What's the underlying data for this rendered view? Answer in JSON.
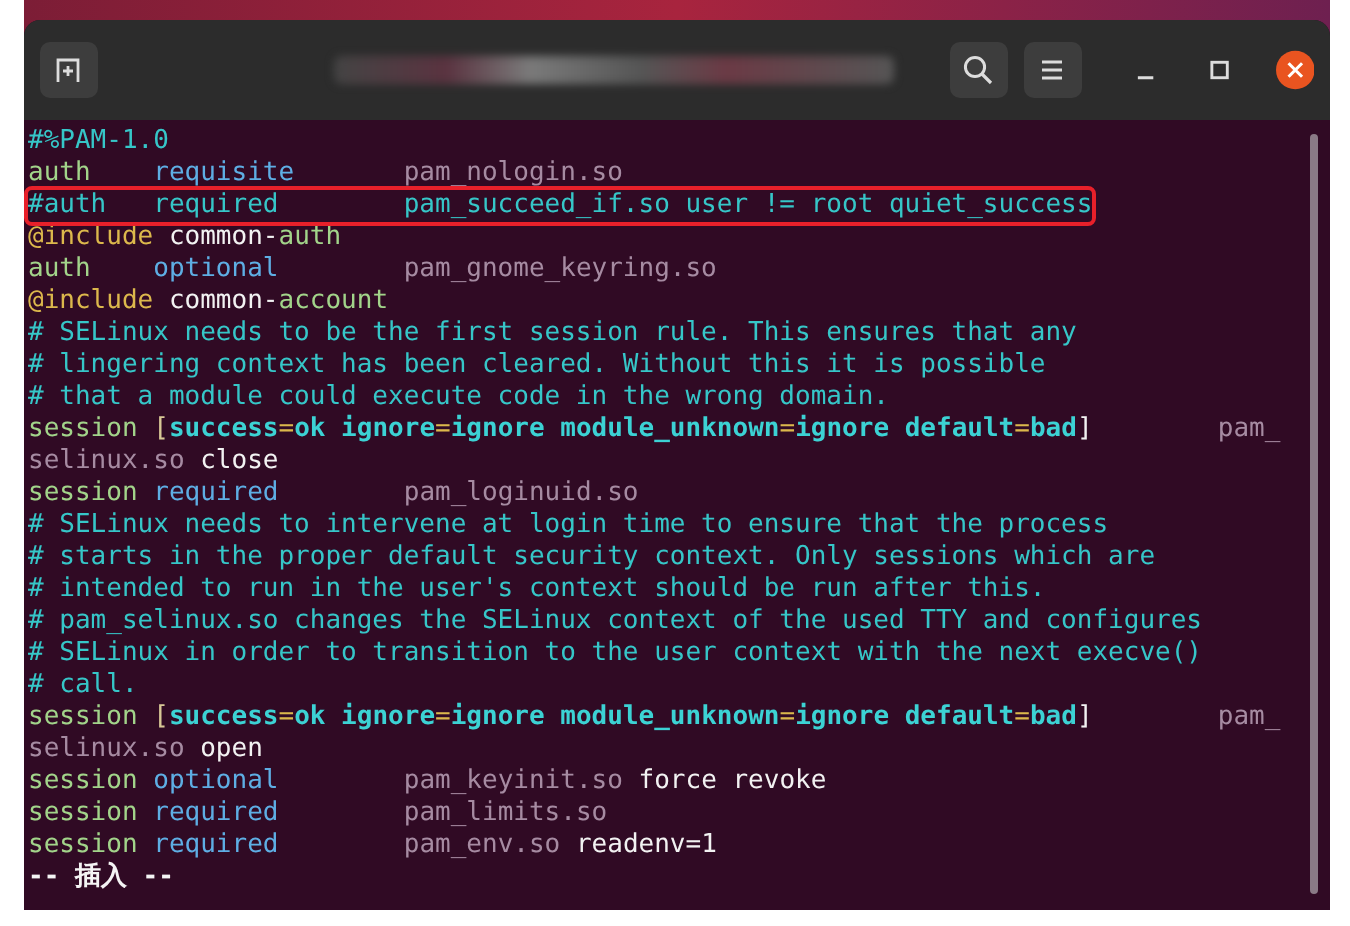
{
  "lines": [
    {
      "highlighted": false,
      "segments": [
        {
          "kind": "comment",
          "text": "#%PAM-1.0"
        }
      ]
    },
    {
      "highlighted": false,
      "segments": [
        {
          "kind": "facility",
          "text": "auth"
        },
        {
          "kind": "control",
          "text": "    requisite"
        },
        {
          "kind": "module",
          "text": "       pam_nologin.so"
        }
      ]
    },
    {
      "highlighted": true,
      "segments": [
        {
          "kind": "comment",
          "text": "#auth   required        pam_succeed_if.so user != root quiet_success"
        }
      ]
    },
    {
      "highlighted": false,
      "segments": [
        {
          "kind": "include",
          "text": "@include"
        },
        {
          "kind": "plain",
          "text": " common-"
        },
        {
          "kind": "facility",
          "text": "auth"
        }
      ]
    },
    {
      "highlighted": false,
      "segments": [
        {
          "kind": "facility",
          "text": "auth"
        },
        {
          "kind": "control",
          "text": "    optional"
        },
        {
          "kind": "module",
          "text": "        pam_gnome_keyring.so"
        }
      ]
    },
    {
      "highlighted": false,
      "segments": [
        {
          "kind": "include",
          "text": "@include"
        },
        {
          "kind": "plain",
          "text": " common-"
        },
        {
          "kind": "facility",
          "text": "account"
        }
      ]
    },
    {
      "highlighted": false,
      "segments": [
        {
          "kind": "comment",
          "text": "# SELinux needs to be the first session rule. This ensures that any"
        }
      ]
    },
    {
      "highlighted": false,
      "segments": [
        {
          "kind": "comment",
          "text": "# lingering context has been cleared. Without this it is possible"
        }
      ]
    },
    {
      "highlighted": false,
      "segments": [
        {
          "kind": "comment",
          "text": "# that a module could execute code in the wrong domain."
        }
      ]
    },
    {
      "highlighted": false,
      "segments": [
        {
          "kind": "facility",
          "text": "session"
        },
        {
          "kind": "bracket",
          "text": " ["
        },
        {
          "kind": "option",
          "text": "success"
        },
        {
          "kind": "equals",
          "text": "="
        },
        {
          "kind": "option",
          "text": "ok ignore"
        },
        {
          "kind": "equals",
          "text": "="
        },
        {
          "kind": "option",
          "text": "ignore module_unknown"
        },
        {
          "kind": "equals",
          "text": "="
        },
        {
          "kind": "option",
          "text": "ignore default"
        },
        {
          "kind": "equals",
          "text": "="
        },
        {
          "kind": "option",
          "text": "bad"
        },
        {
          "kind": "plain",
          "text": "]"
        },
        {
          "kind": "module",
          "text": "        pam_"
        }
      ]
    },
    {
      "highlighted": false,
      "segments": [
        {
          "kind": "module",
          "text": "selinux.so"
        },
        {
          "kind": "plain",
          "text": " close"
        }
      ]
    },
    {
      "highlighted": false,
      "segments": [
        {
          "kind": "facility",
          "text": "session"
        },
        {
          "kind": "control",
          "text": " required"
        },
        {
          "kind": "module",
          "text": "        pam_loginuid.so"
        }
      ]
    },
    {
      "highlighted": false,
      "segments": [
        {
          "kind": "comment",
          "text": "# SELinux needs to intervene at login time to ensure that the process"
        }
      ]
    },
    {
      "highlighted": false,
      "segments": [
        {
          "kind": "comment",
          "text": "# starts in the proper default security context. Only sessions which are"
        }
      ]
    },
    {
      "highlighted": false,
      "segments": [
        {
          "kind": "comment",
          "text": "# intended to run in the user's context should be run after this."
        }
      ]
    },
    {
      "highlighted": false,
      "segments": [
        {
          "kind": "comment",
          "text": "# pam_selinux.so changes the SELinux context of the used TTY and configures"
        }
      ]
    },
    {
      "highlighted": false,
      "segments": [
        {
          "kind": "comment",
          "text": "# SELinux in order to transition to the user context with the next execve()"
        }
      ]
    },
    {
      "highlighted": false,
      "segments": [
        {
          "kind": "comment",
          "text": "# call."
        }
      ]
    },
    {
      "highlighted": false,
      "segments": [
        {
          "kind": "facility",
          "text": "session"
        },
        {
          "kind": "bracket",
          "text": " ["
        },
        {
          "kind": "option",
          "text": "success"
        },
        {
          "kind": "equals",
          "text": "="
        },
        {
          "kind": "option",
          "text": "ok ignore"
        },
        {
          "kind": "equals",
          "text": "="
        },
        {
          "kind": "option",
          "text": "ignore module_unknown"
        },
        {
          "kind": "equals",
          "text": "="
        },
        {
          "kind": "option",
          "text": "ignore default"
        },
        {
          "kind": "equals",
          "text": "="
        },
        {
          "kind": "option",
          "text": "bad"
        },
        {
          "kind": "plain",
          "text": "]"
        },
        {
          "kind": "module",
          "text": "        pam_"
        }
      ]
    },
    {
      "highlighted": false,
      "segments": [
        {
          "kind": "module",
          "text": "selinux.so"
        },
        {
          "kind": "plain",
          "text": " open"
        }
      ]
    },
    {
      "highlighted": false,
      "segments": [
        {
          "kind": "facility",
          "text": "session"
        },
        {
          "kind": "control",
          "text": " optional"
        },
        {
          "kind": "module",
          "text": "        pam_keyinit.so"
        },
        {
          "kind": "plain",
          "text": " force revoke"
        }
      ]
    },
    {
      "highlighted": false,
      "segments": [
        {
          "kind": "facility",
          "text": "session"
        },
        {
          "kind": "control",
          "text": " required"
        },
        {
          "kind": "module",
          "text": "        pam_limits.so"
        }
      ]
    },
    {
      "highlighted": false,
      "segments": [
        {
          "kind": "facility",
          "text": "session"
        },
        {
          "kind": "control",
          "text": " required"
        },
        {
          "kind": "module",
          "text": "        pam_env.so"
        },
        {
          "kind": "plain",
          "text": " readenv=1"
        }
      ]
    }
  ],
  "mode_line": "-- 插入 --"
}
